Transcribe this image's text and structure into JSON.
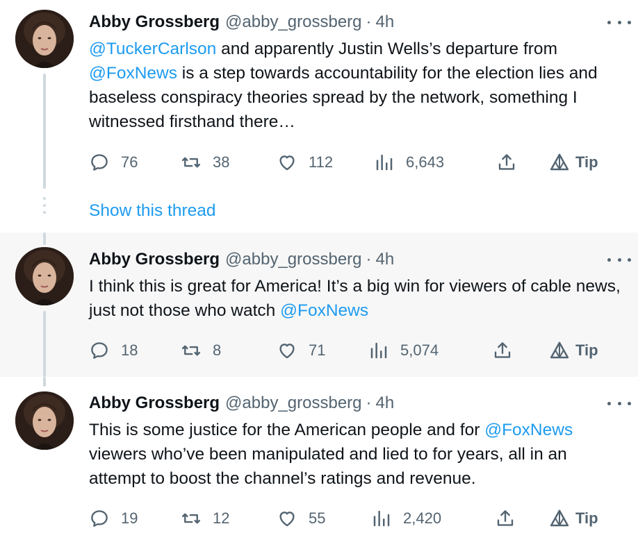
{
  "tweets": [
    {
      "name": "Abby Grossberg",
      "handle": "@abby_grossberg",
      "separator": "·",
      "time": "4h",
      "text_parts": [
        {
          "t": "@TuckerCarlson",
          "mention": true
        },
        {
          "t": " and apparently Justin Wells’s departure from ",
          "mention": false
        },
        {
          "t": "@FoxNews",
          "mention": true
        },
        {
          "t": " is a step towards accountability for the election lies and baseless conspiracy theories spread by the network, something I witnessed firsthand there…",
          "mention": false
        }
      ],
      "replies": "76",
      "retweets": "38",
      "likes": "112",
      "views": "6,643",
      "tip": "Tip"
    },
    {
      "name": "Abby Grossberg",
      "handle": "@abby_grossberg",
      "separator": "·",
      "time": "4h",
      "text_parts": [
        {
          "t": "I think this is great for America! It’s a big win for viewers of cable news, just not those who watch ",
          "mention": false
        },
        {
          "t": "@FoxNews",
          "mention": true
        }
      ],
      "replies": "18",
      "retweets": "8",
      "likes": "71",
      "views": "5,074",
      "tip": "Tip"
    },
    {
      "name": "Abby Grossberg",
      "handle": "@abby_grossberg",
      "separator": "·",
      "time": "4h",
      "text_parts": [
        {
          "t": "This is some justice for the American people and for ",
          "mention": false
        },
        {
          "t": "@FoxNews",
          "mention": true
        },
        {
          "t": " viewers who’ve been manipulated and lied to for years, all in an attempt to boost the channel’s ratings and revenue.",
          "mention": false
        }
      ],
      "replies": "19",
      "retweets": "12",
      "likes": "55",
      "views": "2,420",
      "tip": "Tip"
    }
  ],
  "show_thread_label": "Show this thread",
  "colors": {
    "accent": "#1d9bf0",
    "secondary_text": "#536471",
    "thread_line": "#cfd9de",
    "highlight_bg": "#f7f7f7"
  },
  "icons": [
    "more-icon",
    "reply-icon",
    "retweet-icon",
    "like-icon",
    "views-icon",
    "share-icon",
    "tip-icon"
  ]
}
